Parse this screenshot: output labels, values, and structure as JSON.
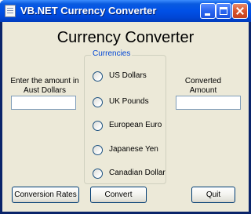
{
  "window": {
    "title": "VB.NET Currency Converter",
    "controls": {
      "minimize_icon": "minimize-icon",
      "maximize_icon": "maximize-icon",
      "close_icon": "close-icon"
    }
  },
  "form": {
    "heading": "Currency Converter",
    "amount_label": "Enter the amount in Aust Dollars",
    "amount_value": "",
    "converted_label": "Converted Amount",
    "converted_value": "",
    "currencies_group_title": "Currencies",
    "currencies": [
      {
        "label": "US Dollars",
        "selected": false
      },
      {
        "label": "UK Pounds",
        "selected": false
      },
      {
        "label": "European Euro",
        "selected": false
      },
      {
        "label": "Japanese Yen",
        "selected": false
      },
      {
        "label": "Canadian Dollar",
        "selected": false
      }
    ],
    "buttons": {
      "rates": "Conversion Rates",
      "convert": "Convert",
      "quit": "Quit"
    }
  },
  "colors": {
    "title_bar": "#0050e6",
    "client_bg": "#ece9d8",
    "group_title": "#0046d5",
    "close_button": "#d8542c"
  }
}
